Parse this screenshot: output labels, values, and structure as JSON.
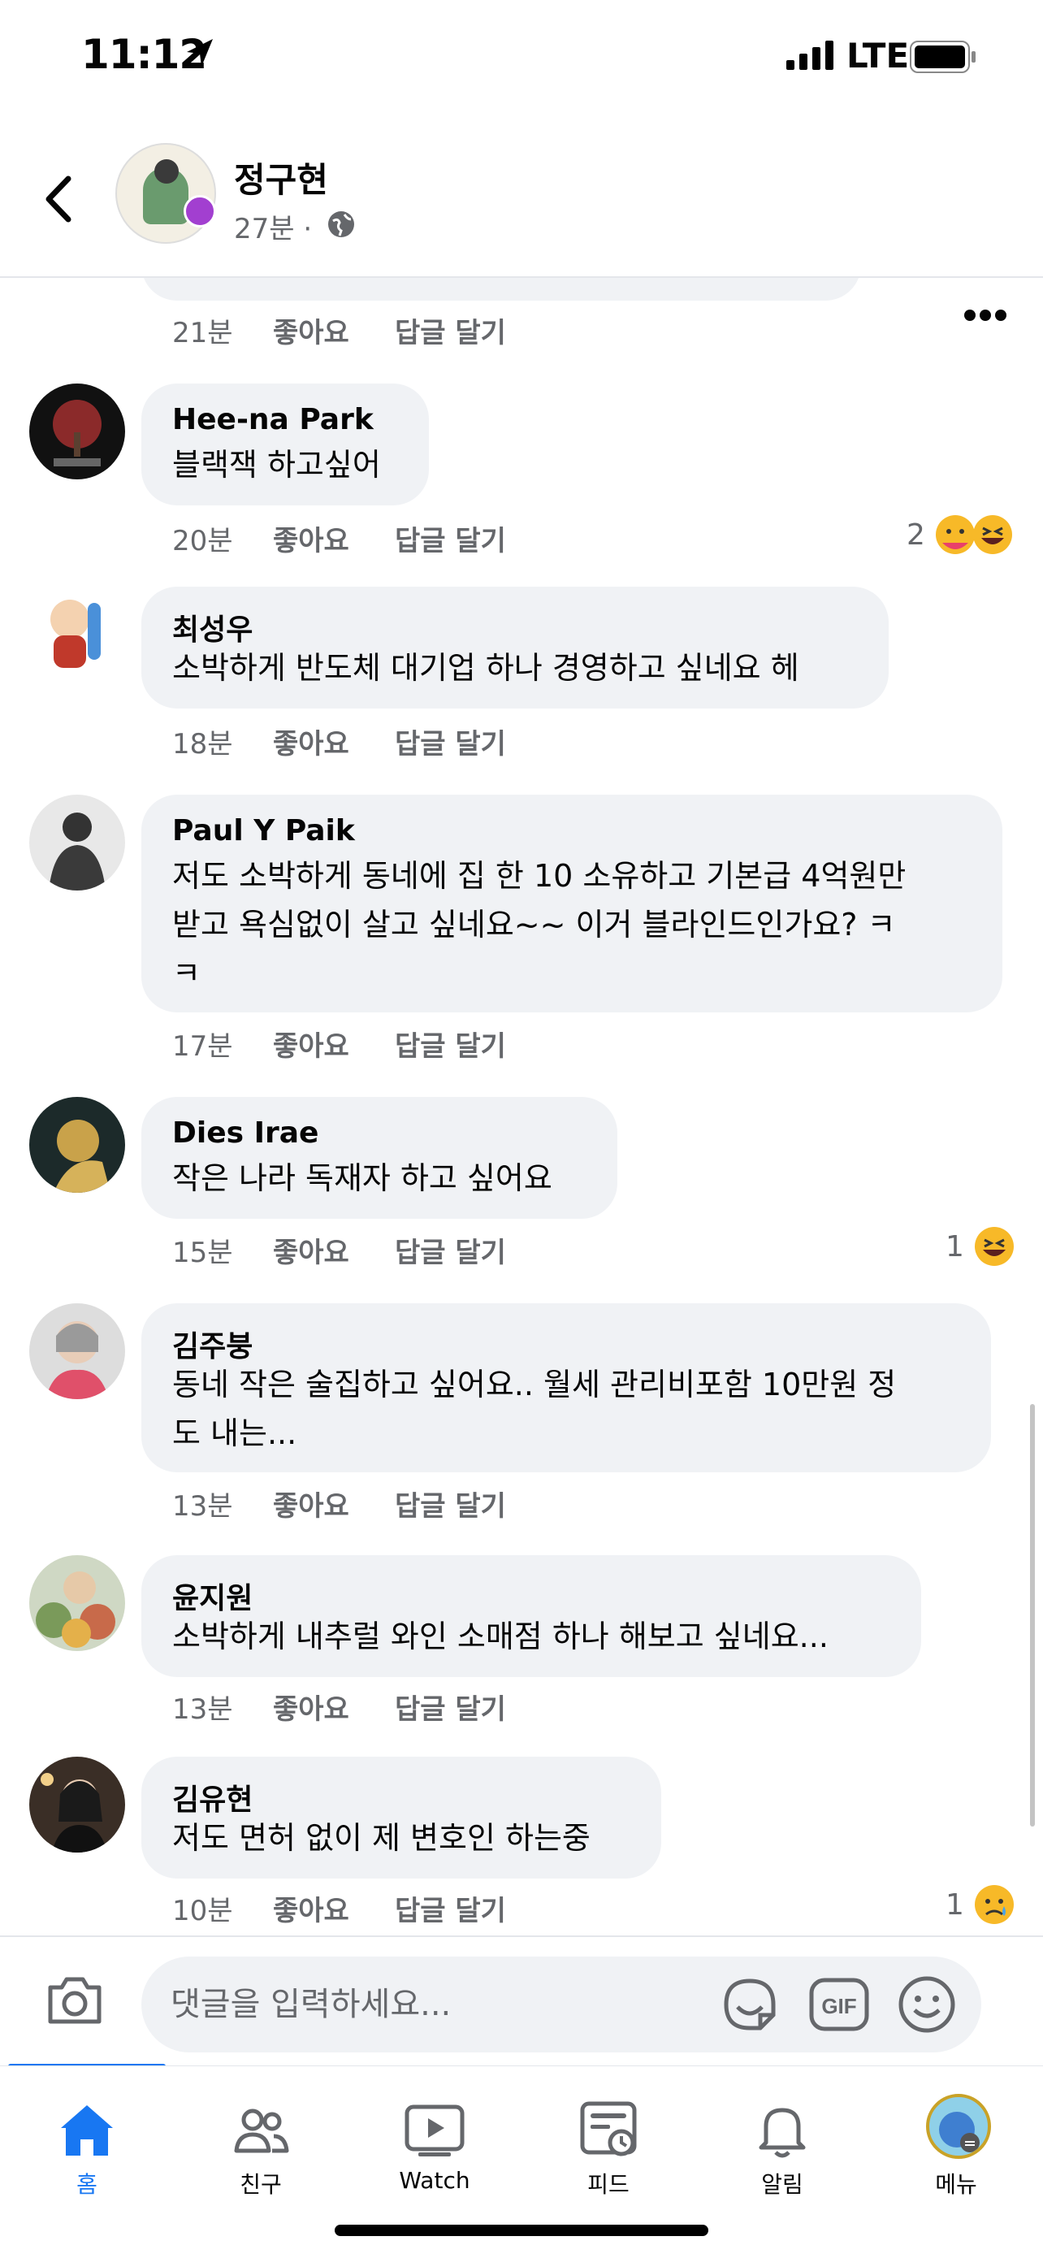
{
  "status_bar": {
    "time": "11:12",
    "network": "LTE"
  },
  "header": {
    "author": "정구현",
    "meta": "27분 ·"
  },
  "comments": [
    {
      "time": "21분",
      "like": "좋아요",
      "reply": "답글 달기"
    },
    {
      "name": "Hee-na Park",
      "lines": [
        "블랙잭 하고싶어"
      ],
      "time": "20분",
      "like": "좋아요",
      "reply": "답글 달기",
      "reactions": {
        "count": "2",
        "icons": [
          "care-emoji",
          "laugh-emoji"
        ]
      }
    },
    {
      "name": "최성우",
      "lines": [
        "소박하게 반도체 대기업 하나 경영하고 싶네요 헤"
      ],
      "time": "18분",
      "like": "좋아요",
      "reply": "답글 달기"
    },
    {
      "name": "Paul Y Paik",
      "lines": [
        "저도 소박하게 동네에 집 한 10 소유하고 기본급 4억원만",
        "받고 욕심없이 살고 싶네요~~ 이거 블라인드인가요? ㅋ",
        "ㅋ"
      ],
      "time": "17분",
      "like": "좋아요",
      "reply": "답글 달기"
    },
    {
      "name": "Dies Irae",
      "lines": [
        "작은 나라 독재자 하고 싶어요"
      ],
      "time": "15분",
      "like": "좋아요",
      "reply": "답글 달기",
      "reactions": {
        "count": "1",
        "icons": [
          "laugh-emoji"
        ]
      }
    },
    {
      "name": "김주붕",
      "lines": [
        "동네 작은 술집하고 싶어요.. 월세 관리비포함 10만원 정",
        "도 내는..."
      ],
      "time": "13분",
      "like": "좋아요",
      "reply": "답글 달기"
    },
    {
      "name": "윤지원",
      "lines": [
        "소박하게 내추럴 와인 소매점 하나 해보고 싶네요..."
      ],
      "time": "13분",
      "like": "좋아요",
      "reply": "답글 달기"
    },
    {
      "name": "김유현",
      "lines": [
        "저도 면허 없이 제 변호인 하는중"
      ],
      "time": "10분",
      "like": "좋아요",
      "reply": "답글 달기",
      "reactions": {
        "count": "1",
        "icons": [
          "sad-emoji"
        ]
      }
    }
  ],
  "composer": {
    "placeholder": "댓글을 입력하세요..."
  },
  "tabs": [
    {
      "label": "홈",
      "icon": "home-icon",
      "active": true
    },
    {
      "label": "친구",
      "icon": "friends-icon"
    },
    {
      "label": "Watch",
      "icon": "watch-icon"
    },
    {
      "label": "피드",
      "icon": "feed-icon"
    },
    {
      "label": "알림",
      "icon": "bell-icon"
    },
    {
      "label": "메뉴",
      "icon": "menu-avatar"
    }
  ],
  "colors": {
    "accent": "#1877f2",
    "bubble": "#f0f2f5",
    "secondary_text": "#65676b"
  }
}
